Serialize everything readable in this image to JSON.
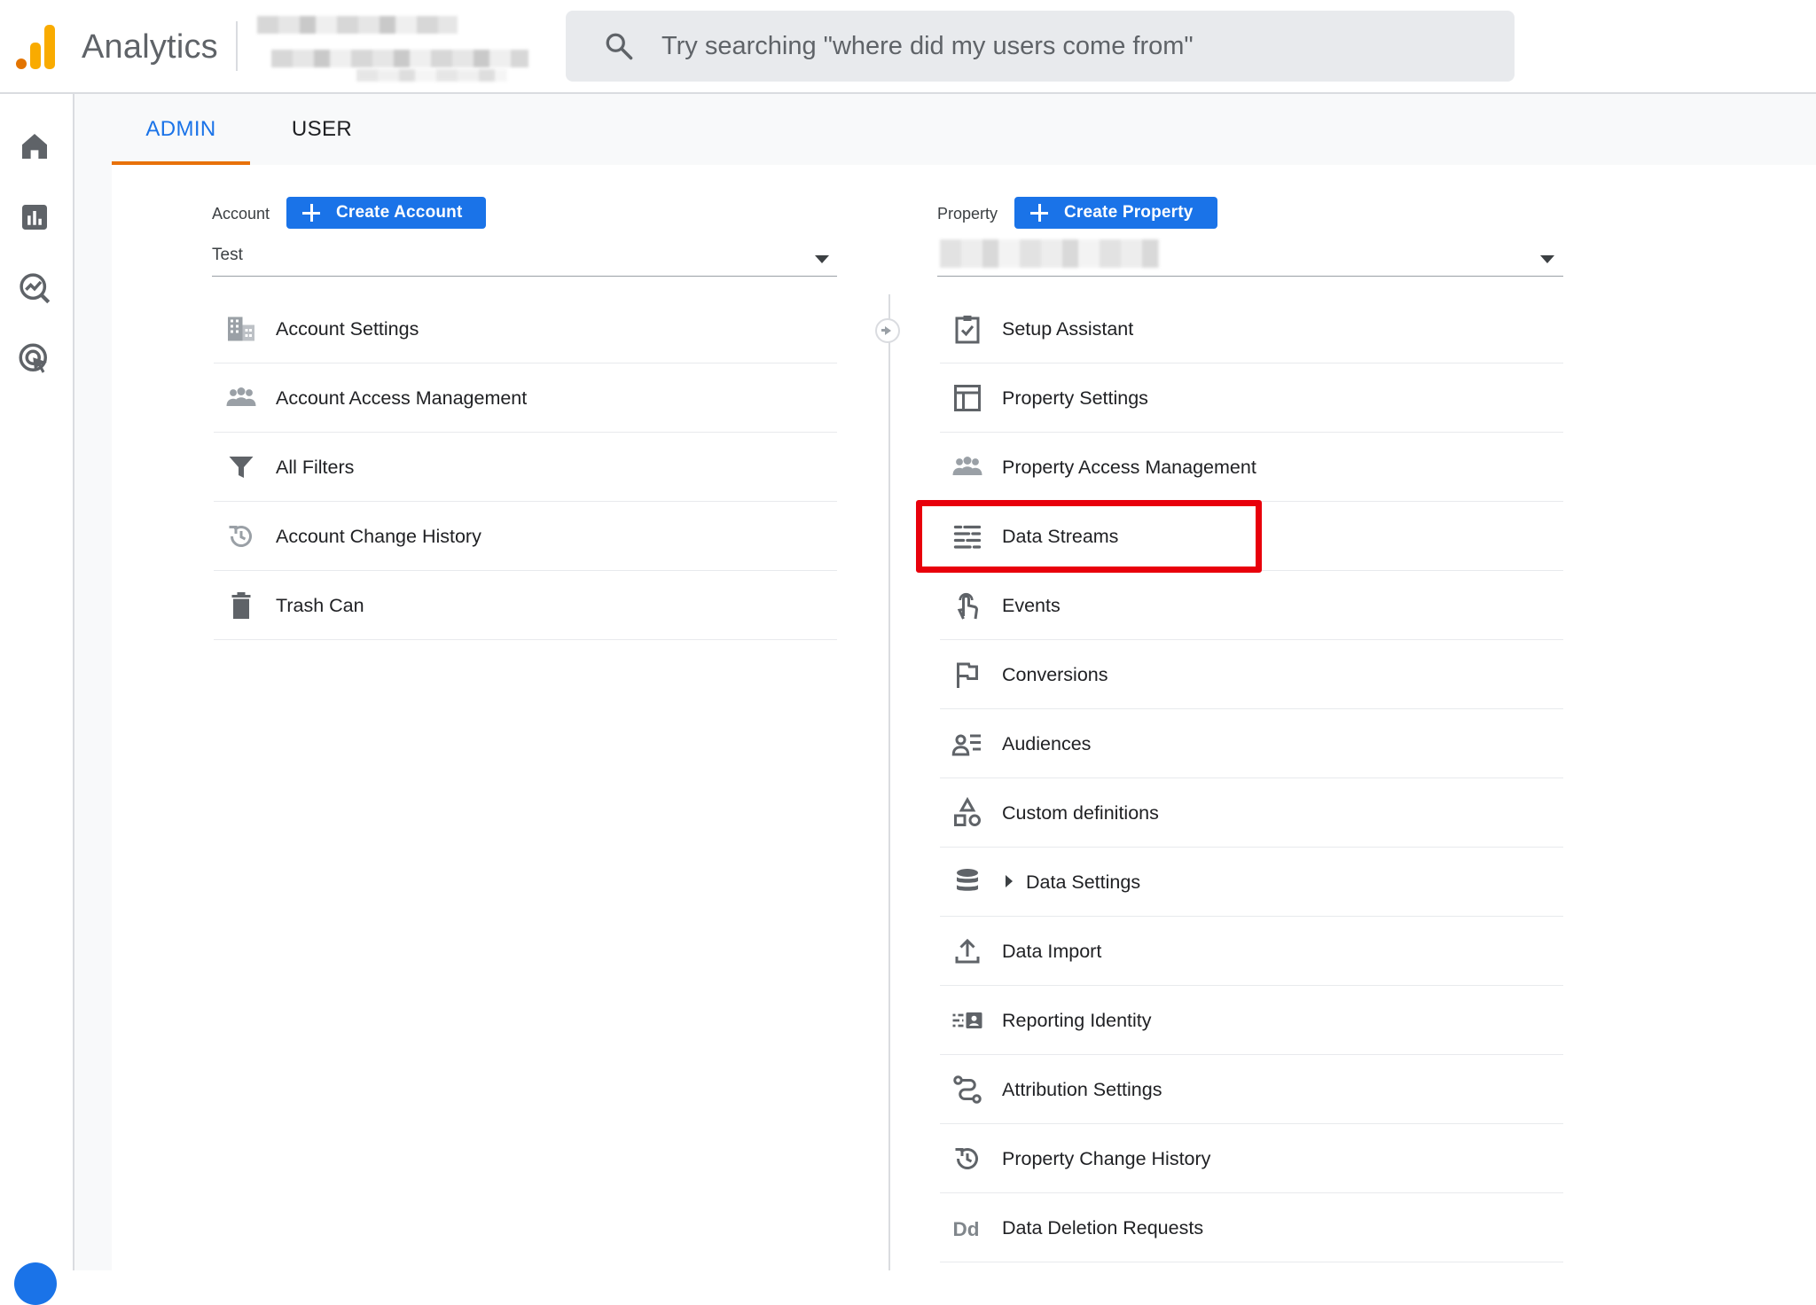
{
  "header": {
    "app_title": "Analytics",
    "search_placeholder": "Try searching \"where did my users come from\""
  },
  "rail": {
    "items": [
      "home-icon",
      "reports-icon",
      "explore-icon",
      "advertising-icon"
    ]
  },
  "tabs": [
    {
      "label": "ADMIN",
      "selected": true
    },
    {
      "label": "USER",
      "selected": false
    }
  ],
  "account": {
    "label": "Account",
    "create_label": "Create Account",
    "selected": "Test",
    "items": [
      {
        "label": "Account Settings",
        "icon": "building-icon"
      },
      {
        "label": "Account Access Management",
        "icon": "people-icon"
      },
      {
        "label": "All Filters",
        "icon": "filter-icon"
      },
      {
        "label": "Account Change History",
        "icon": "history-icon"
      },
      {
        "label": "Trash Can",
        "icon": "trash-icon"
      }
    ]
  },
  "property": {
    "label": "Property",
    "create_label": "Create Property",
    "items": [
      {
        "label": "Setup Assistant",
        "icon": "checklist-icon"
      },
      {
        "label": "Property Settings",
        "icon": "layout-icon"
      },
      {
        "label": "Property Access Management",
        "icon": "people-icon"
      },
      {
        "label": "Data Streams",
        "icon": "streams-icon",
        "highlighted": true
      },
      {
        "label": "Events",
        "icon": "touch-icon"
      },
      {
        "label": "Conversions",
        "icon": "flag-icon"
      },
      {
        "label": "Audiences",
        "icon": "audience-icon"
      },
      {
        "label": "Custom definitions",
        "icon": "shapes-icon"
      },
      {
        "label": "Data Settings",
        "icon": "database-icon",
        "expandable": true
      },
      {
        "label": "Data Import",
        "icon": "upload-icon"
      },
      {
        "label": "Reporting Identity",
        "icon": "identity-icon"
      },
      {
        "label": "Attribution Settings",
        "icon": "attribution-icon"
      },
      {
        "label": "Property Change History",
        "icon": "history-icon"
      },
      {
        "label": "Data Deletion Requests",
        "icon": "dd-icon"
      }
    ]
  },
  "colors": {
    "accent": "#1a73e8",
    "tab_indicator": "#e8710a",
    "highlight": "#e8000b",
    "icon_gray": "#5f6368"
  }
}
